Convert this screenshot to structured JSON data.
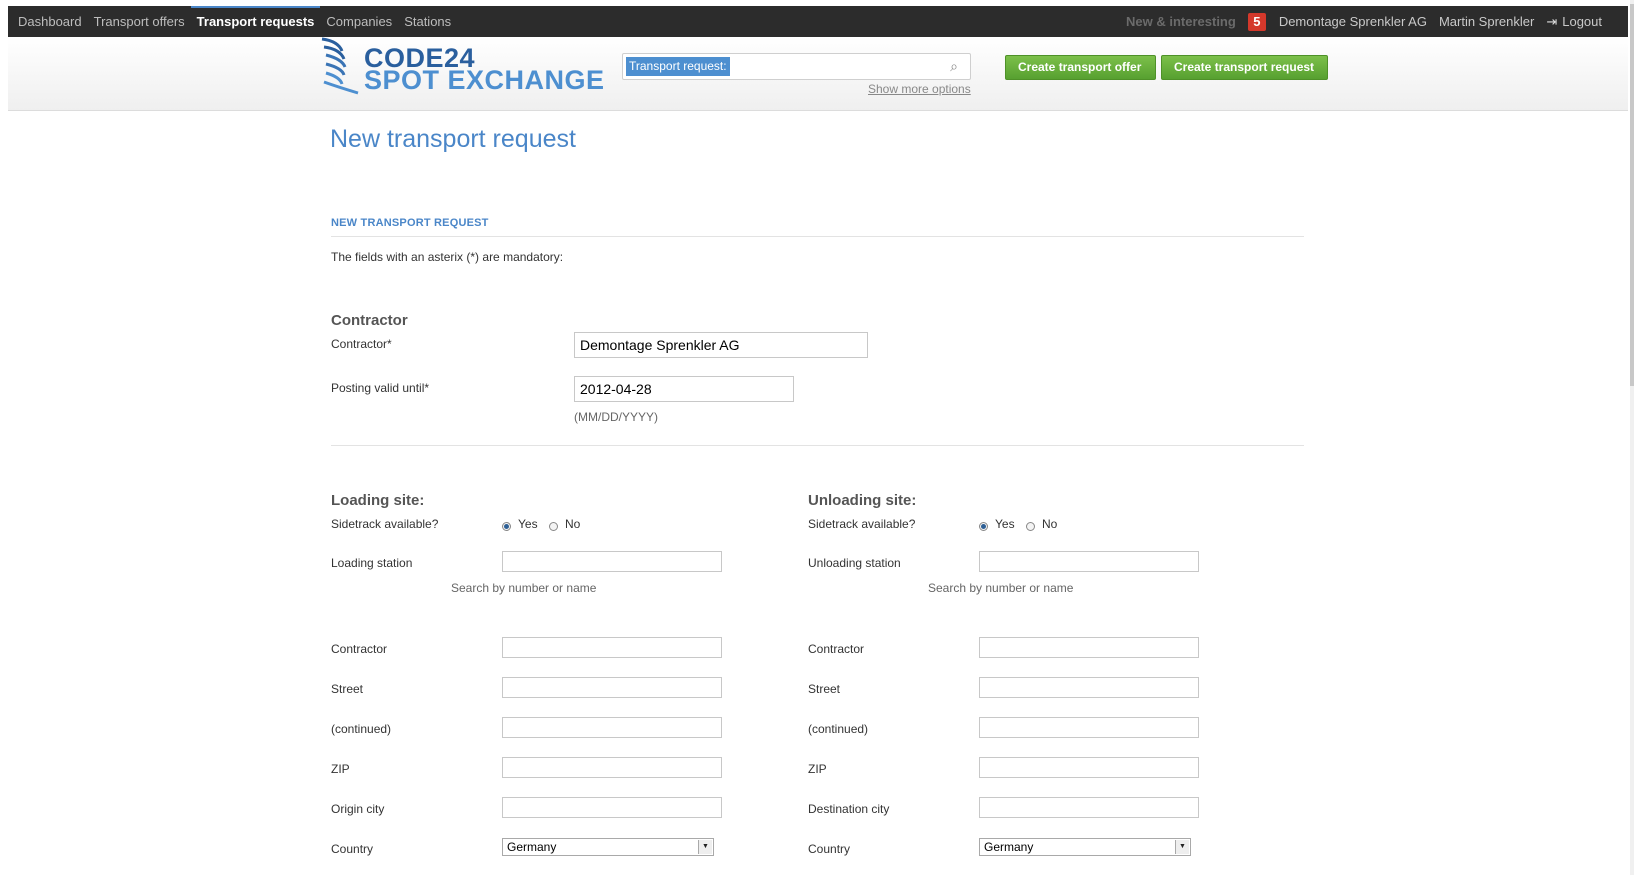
{
  "nav": {
    "items": [
      "Dashboard",
      "Transport offers",
      "Transport requests",
      "Companies",
      "Stations"
    ],
    "new_interesting": "New & interesting",
    "badge_count": "5",
    "company": "Demontage Sprenkler AG",
    "user": "Martin Sprenkler",
    "logout": "Logout"
  },
  "header": {
    "logo_line1": "CODE24",
    "logo_line2": "SPOT EXCHANGE",
    "search_tag": "Transport request:",
    "show_more": "Show more options",
    "create_offer": "Create transport offer",
    "create_request": "Create transport request"
  },
  "page": {
    "title": "New transport request",
    "section": "NEW TRANSPORT REQUEST",
    "mandatory_note": "The fields with an asterix (*) are mandatory:"
  },
  "contractor_section": {
    "heading": "Contractor",
    "contractor_label": "Contractor*",
    "contractor_value": "Demontage Sprenkler AG",
    "valid_label": "Posting valid until*",
    "valid_value": "2012-04-28",
    "valid_hint": "(MM/DD/YYYY)"
  },
  "loading": {
    "heading": "Loading site:",
    "sidetrack": "Sidetrack available?",
    "yes": "Yes",
    "no": "No",
    "station_label": "Loading station",
    "station_hint": "Search by number or name",
    "contractor": "Contractor",
    "street": "Street",
    "continued": "(continued)",
    "zip": "ZIP",
    "city": "Origin city",
    "country": "Country",
    "country_value": "Germany"
  },
  "unloading": {
    "heading": "Unloading site:",
    "sidetrack": "Sidetrack available?",
    "yes": "Yes",
    "no": "No",
    "station_label": "Unloading station",
    "station_hint": "Search by number or name",
    "contractor": "Contractor",
    "street": "Street",
    "continued": "(continued)",
    "zip": "ZIP",
    "city": "Destination city",
    "country": "Country",
    "country_value": "Germany"
  }
}
